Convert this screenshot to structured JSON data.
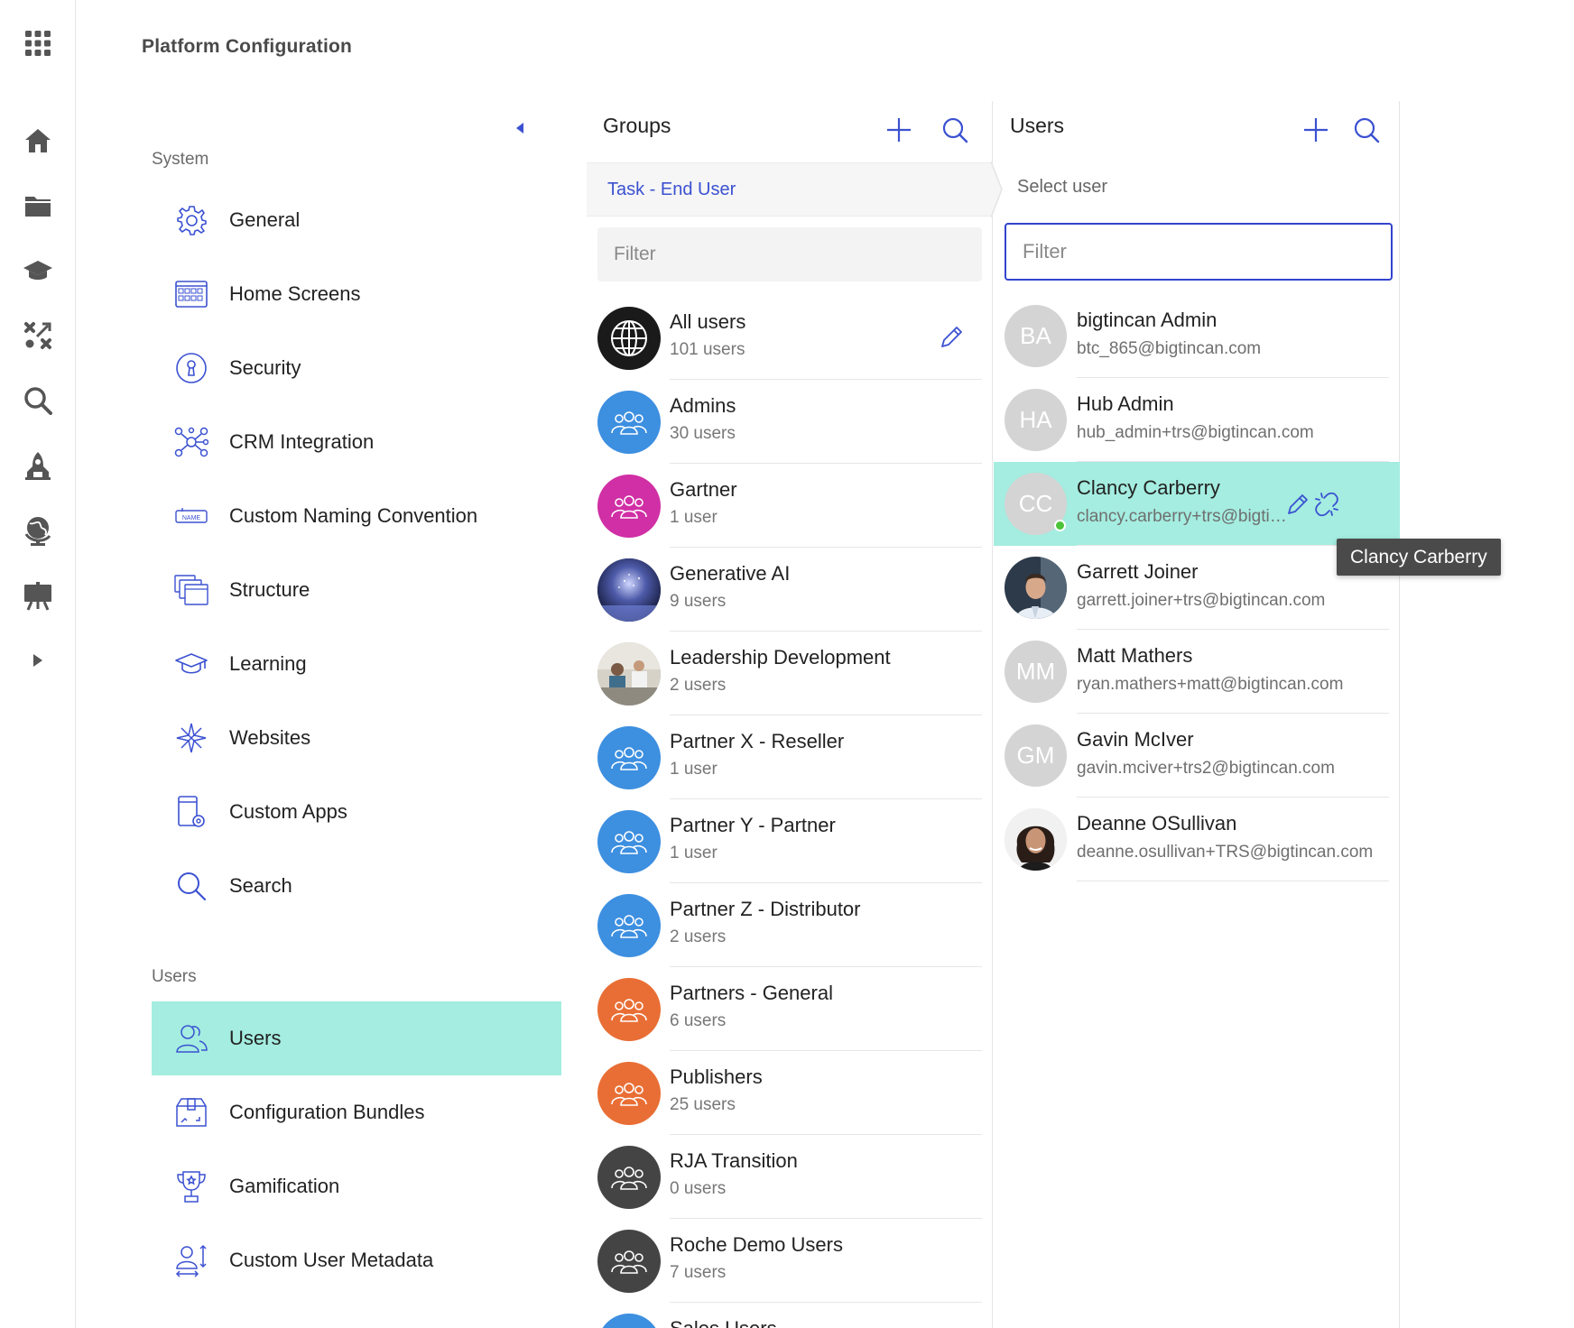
{
  "page": {
    "title": "Platform Configuration"
  },
  "rail": {
    "icons": [
      "apps-grid-icon",
      "home-icon",
      "folder-icon",
      "graduation-cap-icon",
      "strategy-icon",
      "search-icon",
      "rocket-icon",
      "globe-icon",
      "presentation-icon",
      "expand-arrow-icon"
    ]
  },
  "nav": {
    "system_label": "System",
    "system_items": [
      {
        "label": "General",
        "icon": "gear-icon"
      },
      {
        "label": "Home Screens",
        "icon": "home-screens-icon"
      },
      {
        "label": "Security",
        "icon": "lock-icon"
      },
      {
        "label": "CRM Integration",
        "icon": "network-icon"
      },
      {
        "label": "Custom Naming Convention",
        "icon": "name-tag-icon"
      },
      {
        "label": "Structure",
        "icon": "structure-icon"
      },
      {
        "label": "Learning",
        "icon": "graduation-cap-icon"
      },
      {
        "label": "Websites",
        "icon": "compass-icon"
      },
      {
        "label": "Custom Apps",
        "icon": "tablet-gear-icon"
      },
      {
        "label": "Search",
        "icon": "search-icon"
      }
    ],
    "users_label": "Users",
    "users_items": [
      {
        "label": "Users",
        "icon": "users-icon",
        "active": true
      },
      {
        "label": "Configuration Bundles",
        "icon": "bundle-icon"
      },
      {
        "label": "Gamification",
        "icon": "trophy-icon"
      },
      {
        "label": "Custom User Metadata",
        "icon": "user-metadata-icon"
      }
    ]
  },
  "groups": {
    "title": "Groups",
    "breadcrumb": "Task - End User",
    "filter_placeholder": "Filter",
    "items": [
      {
        "name": "All users",
        "count": "101 users",
        "avatar": "globe",
        "color": "#1a1a1a"
      },
      {
        "name": "Admins",
        "count": "30 users",
        "avatar": "group",
        "color": "#3d8fe0"
      },
      {
        "name": "Gartner",
        "count": "1 user",
        "avatar": "group",
        "color": "#d02fa5"
      },
      {
        "name": "Generative AI",
        "count": "9 users",
        "avatar": "photo-ai",
        "color": "#2b3a72"
      },
      {
        "name": "Leadership Development",
        "count": "2 users",
        "avatar": "photo-team",
        "color": "#9aa8a6"
      },
      {
        "name": "Partner X - Reseller",
        "count": "1 user",
        "avatar": "group",
        "color": "#3d8fe0"
      },
      {
        "name": "Partner Y - Partner",
        "count": "1 user",
        "avatar": "group",
        "color": "#3d8fe0"
      },
      {
        "name": "Partner Z - Distributor",
        "count": "2 users",
        "avatar": "group",
        "color": "#3d8fe0"
      },
      {
        "name": "Partners - General",
        "count": "6 users",
        "avatar": "group",
        "color": "#e96e35"
      },
      {
        "name": "Publishers",
        "count": "25 users",
        "avatar": "group",
        "color": "#e96e35"
      },
      {
        "name": "RJA Transition",
        "count": "0 users",
        "avatar": "group",
        "color": "#444444"
      },
      {
        "name": "Roche Demo Users",
        "count": "7 users",
        "avatar": "group",
        "color": "#444444"
      },
      {
        "name": "Sales Users",
        "count": "",
        "avatar": "group",
        "color": "#3d8fe0"
      }
    ]
  },
  "users": {
    "title": "Users",
    "select_label": "Select user",
    "filter_placeholder": "Filter",
    "items": [
      {
        "initials": "BA",
        "name": "bigtincan Admin",
        "email": "btc_865@bigtincan.com"
      },
      {
        "initials": "HA",
        "name": "Hub Admin",
        "email": "hub_admin+trs@bigtincan.com"
      },
      {
        "initials": "CC",
        "name": "Clancy Carberry",
        "email": "clancy.carberry+trs@bigtincan.com",
        "hover": true,
        "online": true
      },
      {
        "initials": "",
        "name": "Garrett Joiner",
        "email": "garrett.joiner+trs@bigtincan.com",
        "photo": "man"
      },
      {
        "initials": "MM",
        "name": "Matt Mathers",
        "email": "ryan.mathers+matt@bigtincan.com"
      },
      {
        "initials": "GM",
        "name": "Gavin McIver",
        "email": "gavin.mciver+trs2@bigtincan.com"
      },
      {
        "initials": "",
        "name": "Deanne OSullivan",
        "email": "deanne.osullivan+TRS@bigtincan.com",
        "photo": "woman"
      }
    ],
    "tooltip": "Clancy Carberry"
  },
  "colors": {
    "accent": "#3b51d1",
    "active": "#a4ede0",
    "rail_icon": "#555555"
  }
}
